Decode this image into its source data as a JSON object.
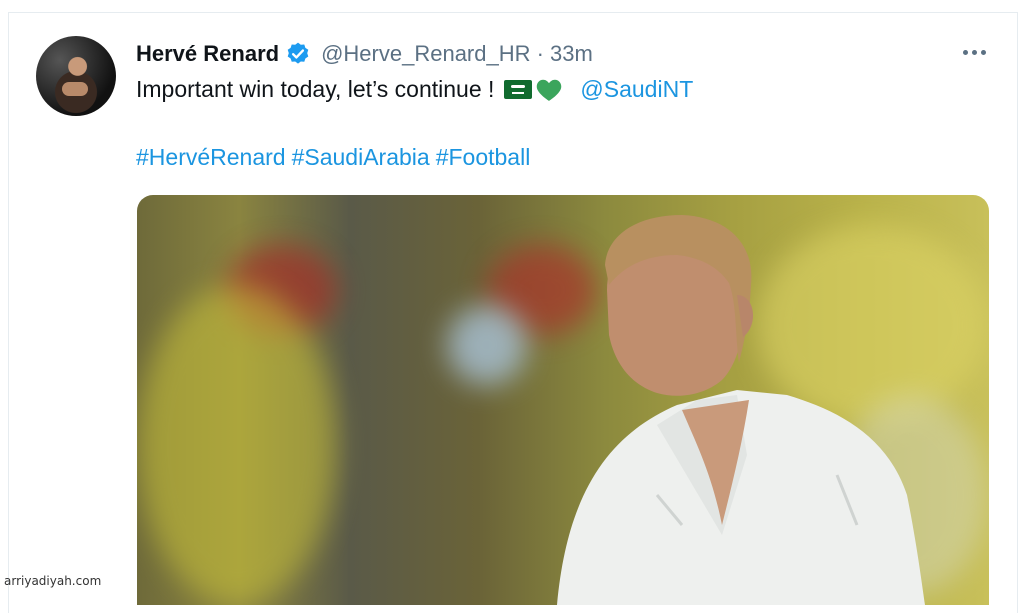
{
  "tweet": {
    "author_name": "Hervé Renard",
    "handle_time": "@Herve_Renard_HR · 33m",
    "text": "Important win today, let’s continue !",
    "mention": "@SaudiNT",
    "hashtags": [
      "#HervéRenard",
      "#SaudiArabia",
      "#Football"
    ]
  },
  "icons": {
    "verified": "verified-badge-icon",
    "more": "more-options-icon",
    "flag": "saudi-flag-emoji",
    "heart": "green-heart-emoji"
  },
  "colors": {
    "link": "#1b95e0",
    "verified": "#1d9bf0",
    "muted": "#5b7083",
    "heart": "#3ba55c"
  },
  "watermark": "arriyadiyah.com"
}
